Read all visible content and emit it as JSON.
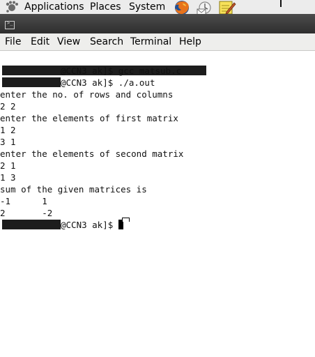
{
  "panel": {
    "menus": [
      "Applications",
      "Places",
      "System"
    ],
    "launchers": [
      "firefox-icon",
      "mail-icon",
      "notes-icon"
    ]
  },
  "window": {
    "menubar": [
      "File",
      "Edit",
      "View",
      "Search",
      "Terminal",
      "Help"
    ]
  },
  "terminal": {
    "prompt_suffix": "@CCN3 ak]$ ",
    "lines": [
      {
        "type": "command",
        "text": "gcc matsub.c"
      },
      {
        "type": "command",
        "text": "./a.out"
      },
      {
        "type": "output",
        "text": "enter the no. of rows and columns"
      },
      {
        "type": "output",
        "text": "2 2"
      },
      {
        "type": "output",
        "text": "enter the elements of first matrix"
      },
      {
        "type": "output",
        "text": "1 2"
      },
      {
        "type": "output",
        "text": "3 1"
      },
      {
        "type": "output",
        "text": "enter the elements of second matrix"
      },
      {
        "type": "output",
        "text": "2 1"
      },
      {
        "type": "output",
        "text": "1 3"
      },
      {
        "type": "output",
        "text": "sum of the given matrices is"
      },
      {
        "type": "output",
        "text": "-1      1"
      },
      {
        "type": "output",
        "text": "2       -2"
      }
    ]
  }
}
